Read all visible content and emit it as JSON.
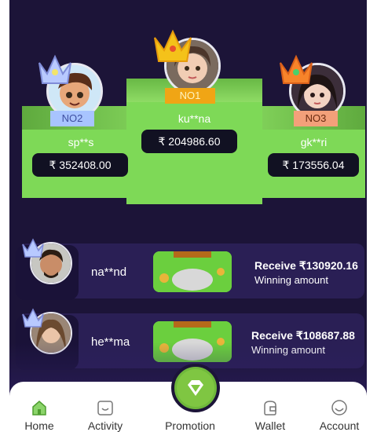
{
  "podium": [
    {
      "rank_label": "NO1",
      "name": "ku**na",
      "amount": "₹ 204986.60"
    },
    {
      "rank_label": "NO2",
      "name": "sp**s",
      "amount": "₹ 352408.00"
    },
    {
      "rank_label": "NO3",
      "name": "gk**ri",
      "amount": "₹ 173556.04"
    }
  ],
  "winners": [
    {
      "name": "na**nd",
      "receive": "Receive ₹130920.16",
      "subtitle": "Winning amount"
    },
    {
      "name": "he**ma",
      "receive": "Receive ₹108687.88",
      "subtitle": "Winning amount"
    }
  ],
  "nav": {
    "items": [
      {
        "label": "Home",
        "icon": "home-icon"
      },
      {
        "label": "Activity",
        "icon": "activity-icon"
      },
      {
        "label": "Promotion",
        "icon": "diamond-icon"
      },
      {
        "label": "Wallet",
        "icon": "wallet-icon"
      },
      {
        "label": "Account",
        "icon": "account-icon"
      }
    ]
  },
  "colors": {
    "background": "#1c1438",
    "podium": "#7ed957",
    "rank1": "#f0a515",
    "rank2": "#a8c4ff",
    "rank3": "#f3a07a",
    "row": "#2a1f55"
  }
}
